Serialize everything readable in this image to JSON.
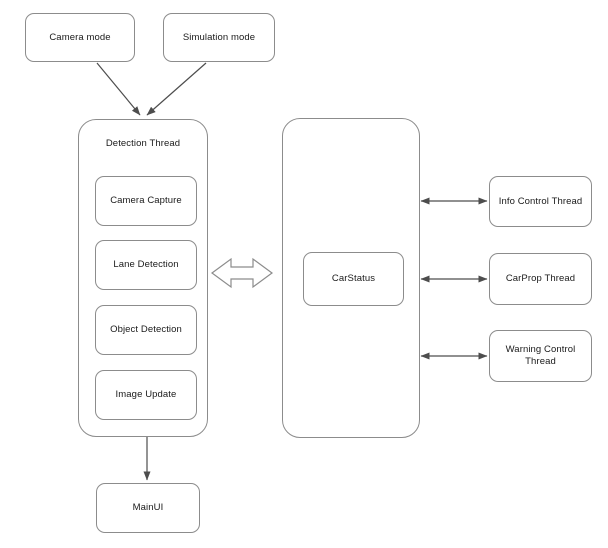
{
  "diagram": {
    "title": "Detection Thread and CarStatus architecture diagram",
    "background_color": "#ffffff",
    "stroke_color": "#8c8c8c",
    "arrow_color": "#4d4d4d",
    "text_color": "#1a1a1a"
  },
  "nodes": {
    "camera_mode": {
      "label": "Camera mode"
    },
    "simulation_mode": {
      "label": "Simulation mode"
    },
    "detection_thread": {
      "label": "Detection Thread"
    },
    "camera_capture": {
      "label": "Camera Capture"
    },
    "lane_detection": {
      "label": "Lane Detection"
    },
    "object_detection": {
      "label": "Object Detection"
    },
    "image_update": {
      "label": "Image Update"
    },
    "main_ui": {
      "label": "MainUI"
    },
    "car_status_container": {
      "label": ""
    },
    "car_status": {
      "label": "CarStatus"
    },
    "info_control_thread": {
      "label": "Info Control Thread"
    },
    "carprop_thread": {
      "label": "CarProp Thread"
    },
    "warning_control_thread": {
      "label": "Warning Control\nThread"
    }
  },
  "connections": [
    {
      "name": "camera-mode-to-detection-thread",
      "from": "camera_mode",
      "to": "detection_thread",
      "style": "single-arrow"
    },
    {
      "name": "simulation-mode-to-detection-thread",
      "from": "simulation_mode",
      "to": "detection_thread",
      "style": "single-arrow"
    },
    {
      "name": "detection-thread-to-car-status",
      "from": "detection_thread",
      "to": "car_status_container",
      "style": "block-double-arrow"
    },
    {
      "name": "image-update-to-main-ui",
      "from": "image_update",
      "to": "main_ui",
      "style": "single-arrow"
    },
    {
      "name": "car-status-to-info-control-thread",
      "from": "car_status_container",
      "to": "info_control_thread",
      "style": "double-arrow"
    },
    {
      "name": "car-status-to-carprop-thread",
      "from": "car_status_container",
      "to": "carprop_thread",
      "style": "double-arrow"
    },
    {
      "name": "car-status-to-warning-control-thread",
      "from": "car_status_container",
      "to": "warning_control_thread",
      "style": "double-arrow"
    }
  ]
}
